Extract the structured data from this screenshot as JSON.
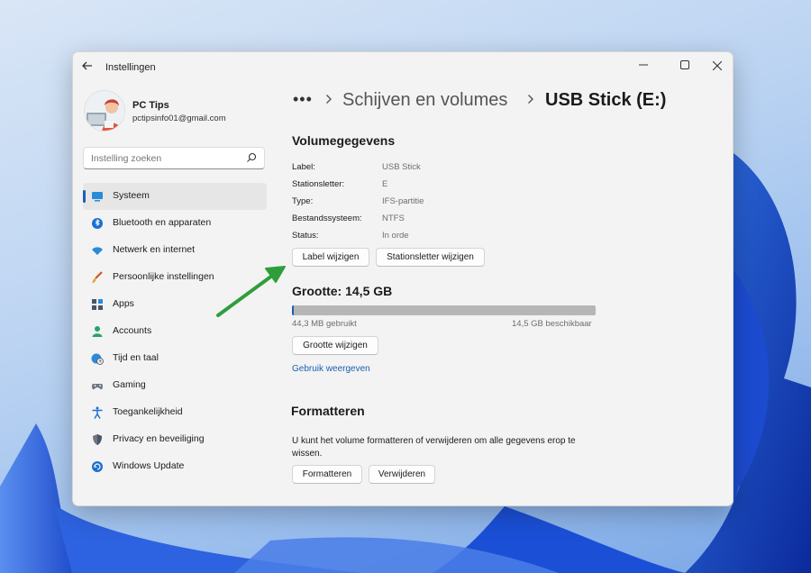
{
  "window": {
    "title": "Instellingen"
  },
  "profile": {
    "name": "PC Tips",
    "email": "pctipsinfo01@gmail.com"
  },
  "search": {
    "placeholder": "Instelling zoeken"
  },
  "sidebar": {
    "items": [
      {
        "label": "Systeem",
        "icon": "monitor-icon",
        "selected": true
      },
      {
        "label": "Bluetooth en apparaten",
        "icon": "bluetooth-icon"
      },
      {
        "label": "Netwerk en internet",
        "icon": "wifi-icon"
      },
      {
        "label": "Persoonlijke instellingen",
        "icon": "brush-icon"
      },
      {
        "label": "Apps",
        "icon": "apps-icon"
      },
      {
        "label": "Accounts",
        "icon": "person-icon"
      },
      {
        "label": "Tijd en taal",
        "icon": "globe-clock-icon"
      },
      {
        "label": "Gaming",
        "icon": "gamepad-icon"
      },
      {
        "label": "Toegankelijkheid",
        "icon": "accessibility-icon"
      },
      {
        "label": "Privacy en beveiliging",
        "icon": "shield-icon"
      },
      {
        "label": "Windows Update",
        "icon": "update-icon"
      }
    ]
  },
  "breadcrumb": {
    "more": "•••",
    "parent": "Schijven en volumes",
    "current": "USB Stick (E:)"
  },
  "volume": {
    "title": "Volumegegevens",
    "props": [
      {
        "key": "Label:",
        "value": "USB Stick"
      },
      {
        "key": "Stationsletter:",
        "value": "E"
      },
      {
        "key": "Type:",
        "value": "IFS-partitie"
      },
      {
        "key": "Bestandssysteem:",
        "value": "NTFS"
      },
      {
        "key": "Status:",
        "value": "In orde"
      }
    ],
    "change_label_button": "Label wijzigen",
    "change_letter_button": "Stationsletter wijzigen"
  },
  "size": {
    "title": "Grootte: 14,5 GB",
    "used_fraction": 0.003,
    "used_text": "44,3 MB gebruikt",
    "free_text": "14,5 GB beschikbaar",
    "change_size_button": "Grootte wijzigen",
    "view_usage_link": "Gebruik weergeven"
  },
  "format": {
    "title": "Formatteren",
    "description": "U kunt het volume formatteren of verwijderen om alle gegevens erop te wissen.",
    "format_button": "Formatteren",
    "delete_button": "Verwijderen"
  },
  "colors": {
    "accent": "#1a5fb4",
    "annotation_arrow": "#2e9e3b"
  }
}
